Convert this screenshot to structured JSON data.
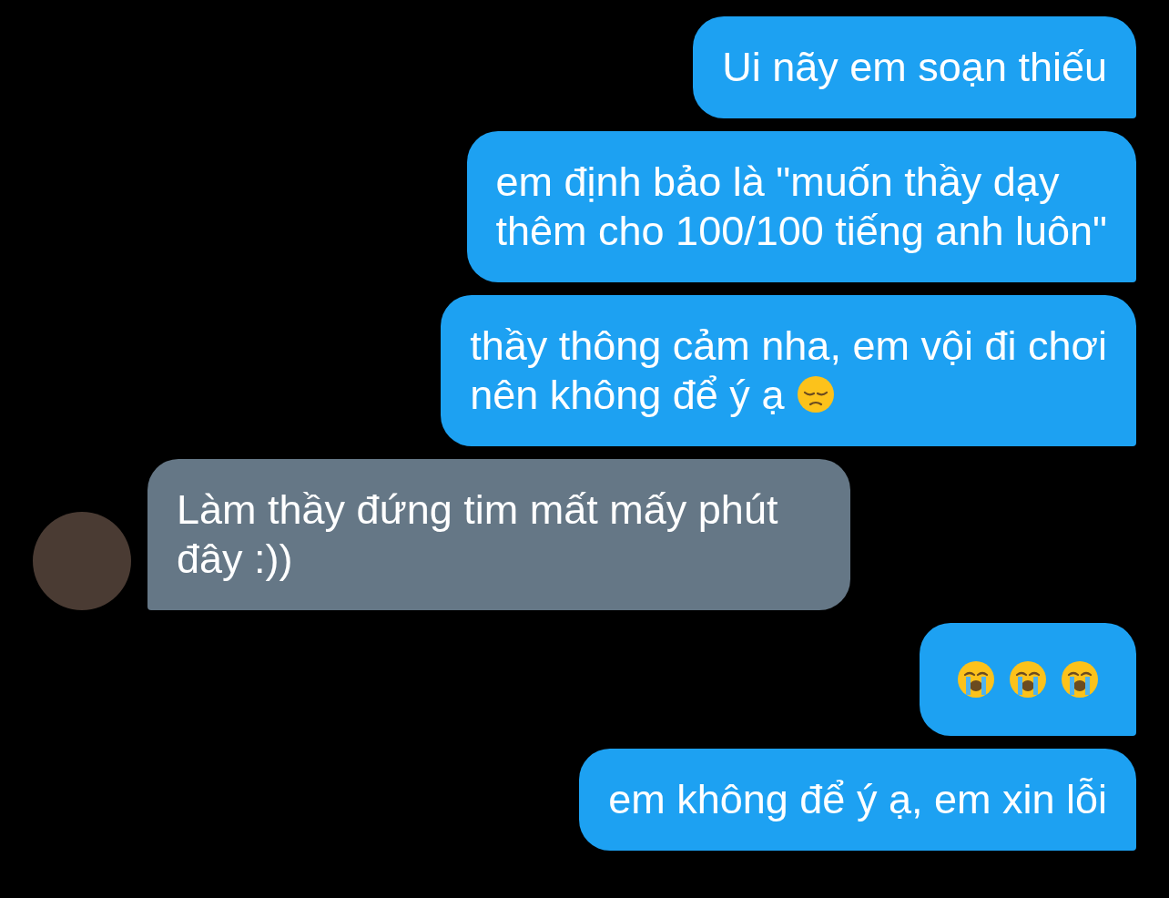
{
  "messages": [
    {
      "outgoing": true,
      "lines": [
        "Ui nãy em soạn thiếu"
      ]
    },
    {
      "outgoing": true,
      "lines": [
        "em định bảo là \"muốn thầy dạy",
        "thêm cho 100/100 tiếng anh luôn\""
      ]
    },
    {
      "outgoing": true,
      "lines": [
        "thầy thông cảm nha, em vội đi chơi",
        "nên không để ý ạ"
      ],
      "emoji": [
        {
          "kind": "pensive"
        }
      ]
    },
    {
      "outgoing": false,
      "lines": [
        "Làm thầy đứng tim mất mấy phút",
        "đây :))"
      ]
    },
    {
      "outgoing": true,
      "emoji": [
        {
          "kind": "crying"
        },
        {
          "kind": "crying"
        },
        {
          "kind": "crying"
        }
      ]
    },
    {
      "outgoing": true,
      "lines": [
        "em không để ý ạ, em xin lỗi"
      ]
    }
  ]
}
